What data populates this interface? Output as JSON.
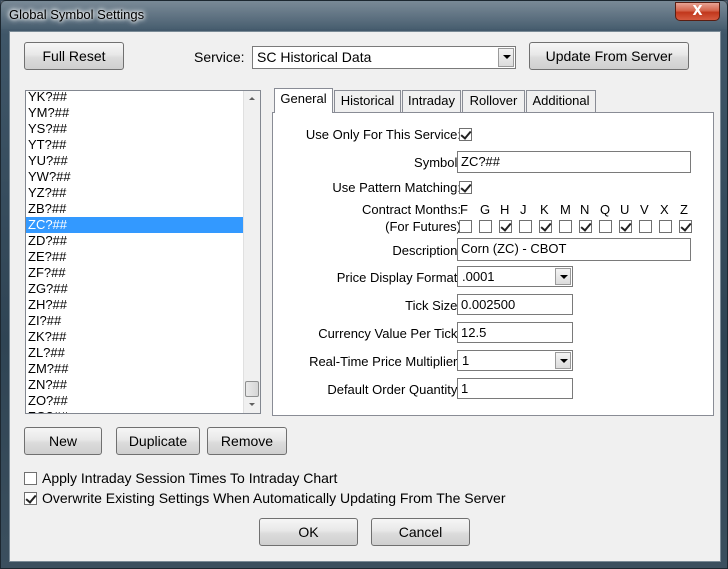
{
  "window": {
    "title": "Global Symbol Settings",
    "close_label": "X"
  },
  "top": {
    "full_reset_label": "Full Reset",
    "service_label": "Service:",
    "service_value": "SC Historical Data",
    "update_label": "Update From Server"
  },
  "symbols": [
    "YK?##",
    "YM?##",
    "YS?##",
    "YT?##",
    "YU?##",
    "YW?##",
    "YZ?##",
    "ZB?##",
    "ZC?##",
    "ZD?##",
    "ZE?##",
    "ZF?##",
    "ZG?##",
    "ZH?##",
    "ZI?##",
    "ZK?##",
    "ZL?##",
    "ZM?##",
    "ZN?##",
    "ZO?##",
    "ZQ?##"
  ],
  "selected_symbol": "ZC?##",
  "tabs": [
    "General",
    "Historical",
    "Intraday",
    "Rollover",
    "Additional"
  ],
  "active_tab": "General",
  "general": {
    "use_only_label": "Use Only For This Service:",
    "use_only_checked": true,
    "symbol_label": "Symbol:",
    "symbol_value": "ZC?##",
    "pattern_label": "Use Pattern Matching:",
    "pattern_checked": true,
    "contract_months_label": "Contract Months:",
    "for_futures_label": "(For Futures)",
    "months": [
      {
        "letter": "F",
        "checked": false
      },
      {
        "letter": "G",
        "checked": false
      },
      {
        "letter": "H",
        "checked": true
      },
      {
        "letter": "J",
        "checked": false
      },
      {
        "letter": "K",
        "checked": true
      },
      {
        "letter": "M",
        "checked": false
      },
      {
        "letter": "N",
        "checked": true
      },
      {
        "letter": "Q",
        "checked": false
      },
      {
        "letter": "U",
        "checked": true
      },
      {
        "letter": "V",
        "checked": false
      },
      {
        "letter": "X",
        "checked": false
      },
      {
        "letter": "Z",
        "checked": true
      }
    ],
    "description_label": "Description:",
    "description_value": "Corn (ZC) - CBOT",
    "price_format_label": "Price Display Format:",
    "price_format_value": ".0001",
    "tick_size_label": "Tick Size:",
    "tick_size_value": "0.002500",
    "currency_label": "Currency Value Per Tick:",
    "currency_value": "12.5",
    "multiplier_label": "Real-Time Price Multiplier:",
    "multiplier_value": "1",
    "order_qty_label": "Default Order Quantity:",
    "order_qty_value": "1"
  },
  "list_buttons": {
    "new": "New",
    "duplicate": "Duplicate",
    "remove": "Remove"
  },
  "options": {
    "apply_intraday_label": "Apply Intraday Session Times To Intraday Chart",
    "apply_intraday_checked": false,
    "overwrite_label": "Overwrite Existing Settings When Automatically Updating From The Server",
    "overwrite_checked": true
  },
  "footer": {
    "ok": "OK",
    "cancel": "Cancel"
  }
}
